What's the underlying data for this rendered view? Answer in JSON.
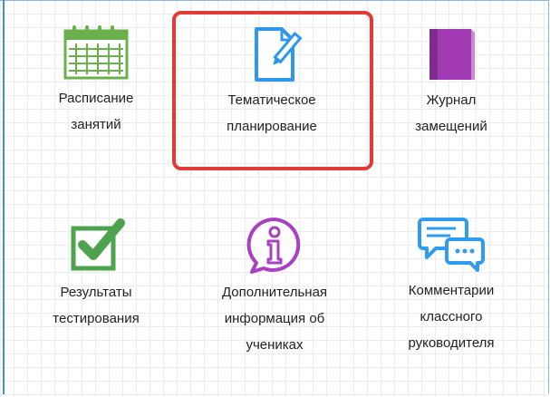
{
  "tiles": [
    {
      "label": "Расписание\nзанятий",
      "icon": "calendar-icon",
      "color": "#6ab04c"
    },
    {
      "label": "Тематическое\nпланирование",
      "icon": "document-pencil-icon",
      "color": "#2f97f0",
      "selected": true
    },
    {
      "label": "Журнал\nзамещений",
      "icon": "journal-icon",
      "color": "#a23ab4"
    },
    {
      "label": "Результаты\nтестирования",
      "icon": "checkbox-icon",
      "color": "#4ea34e"
    },
    {
      "label": "Дополнительная\nинформация об\nучениках",
      "icon": "info-bubble-icon",
      "color": "#a93fc1"
    },
    {
      "label": "Комментарии\nклассного\nруководителя",
      "icon": "chat-bubbles-icon",
      "color": "#2f9cf2"
    }
  ],
  "colors": {
    "selection_border": "#e23b35",
    "grid": "#ececec"
  }
}
